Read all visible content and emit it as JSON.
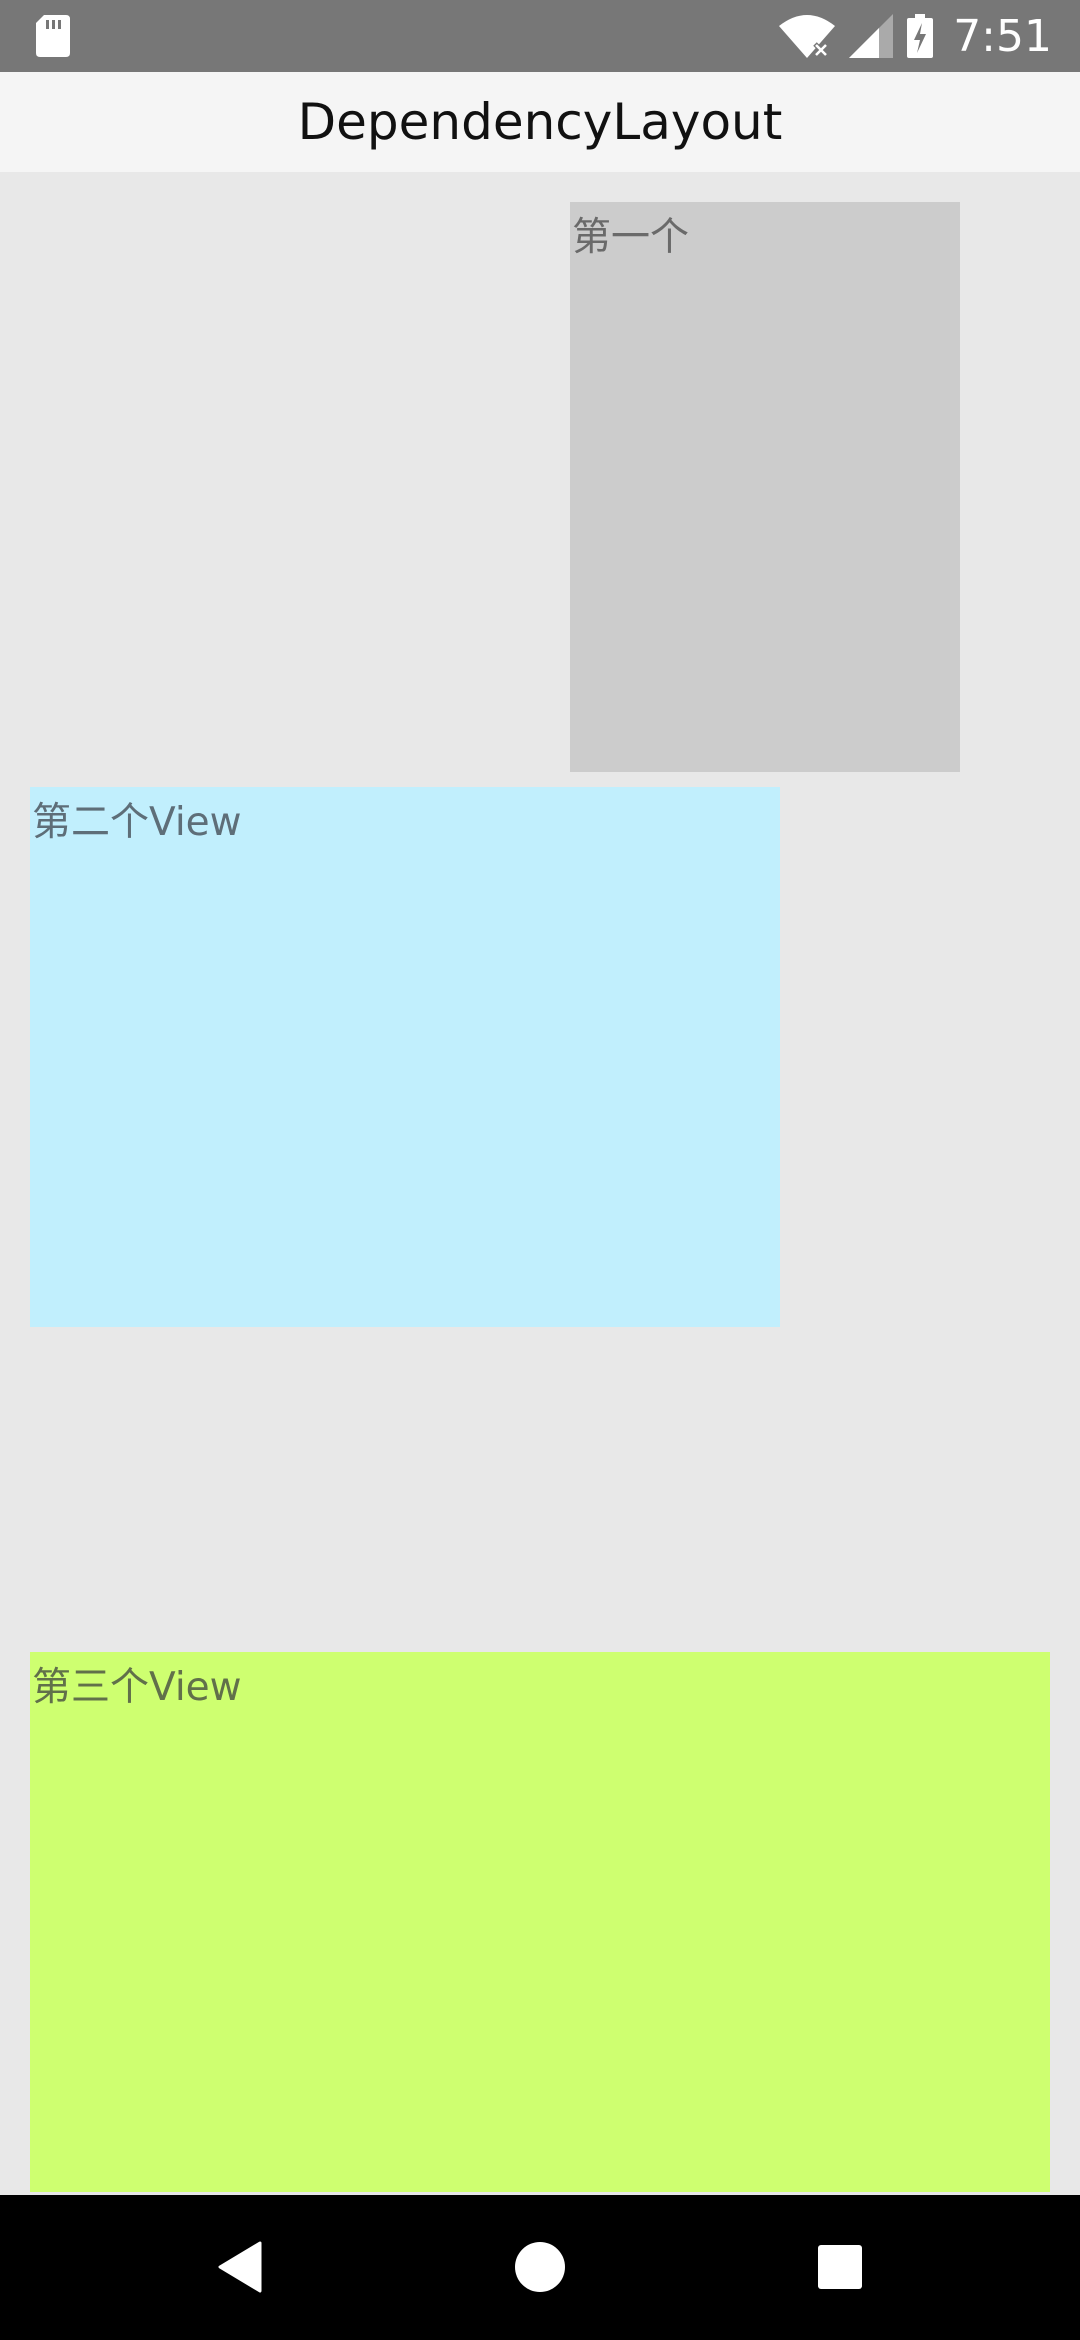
{
  "status_bar": {
    "time": "7:51",
    "icons": [
      "sd-card-icon",
      "wifi-off-icon",
      "signal-icon",
      "battery-charging-icon"
    ]
  },
  "app_bar": {
    "title": "DependencyLayout"
  },
  "views": [
    {
      "label": "第一个",
      "color": "#cccccc"
    },
    {
      "label": "第二个View",
      "color": "#c1effd"
    },
    {
      "label": "第三个View",
      "color": "#ceff70"
    }
  ],
  "nav_bar": {
    "buttons": [
      "back-icon",
      "home-icon",
      "recents-icon"
    ]
  }
}
